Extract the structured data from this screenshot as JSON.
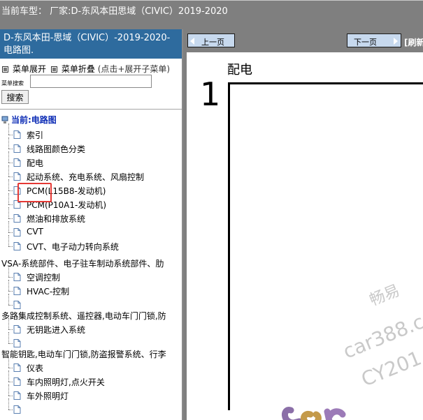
{
  "topbar": {
    "text": "当前车型：  厂家:D-东风本田思域（CIVIC）2019-2020"
  },
  "left": {
    "header": "D-东风本田-思域（CIVIC）-2019-2020- 电路图.",
    "menu_expand": "菜单展开",
    "menu_collapse": "菜单折叠",
    "menu_hint": "(点击+展开子菜单)",
    "search_label": "菜单搜索",
    "search_value": "",
    "search_button": "搜索",
    "tree_root": "当前:电路图",
    "items": [
      "索引",
      "线路图颜色分类",
      "配电",
      "起动系统、充电系统、风扇控制",
      "PCM(L15B8-发动机)",
      "PCM(P10A1-发动机)",
      "燃油和排放系统",
      "CVT",
      "CVT、电子动力转向系统"
    ],
    "group1": "VSA-系统部件、电子驻车制动系统部件、肋",
    "group1_items": [
      "空调控制",
      "HVAC-控制",
      ""
    ],
    "group2": "多路集成控制系统、遥控器,电动车门门锁,防",
    "group2_items": [
      "无钥匙进入系统",
      ""
    ],
    "group3": "智能钥匙,电动车门门锁,防盗报警系统、行李",
    "group3_items": [
      "仪表",
      "车内照明灯,点火开关",
      "车外照明灯",
      ""
    ]
  },
  "right": {
    "prev": "上一页",
    "next": "下一页",
    "refresh": "[刷新",
    "doc_title": "配电",
    "page_num": "1",
    "watermark1": "畅易",
    "watermark2": "car388.c",
    "watermark3": "CY201"
  },
  "colors": {
    "header_blue": "#2e6b9e",
    "gray_bar": "#7f7f7f",
    "highlight_red": "#e53935",
    "root_blue": "#0b2bb5"
  }
}
